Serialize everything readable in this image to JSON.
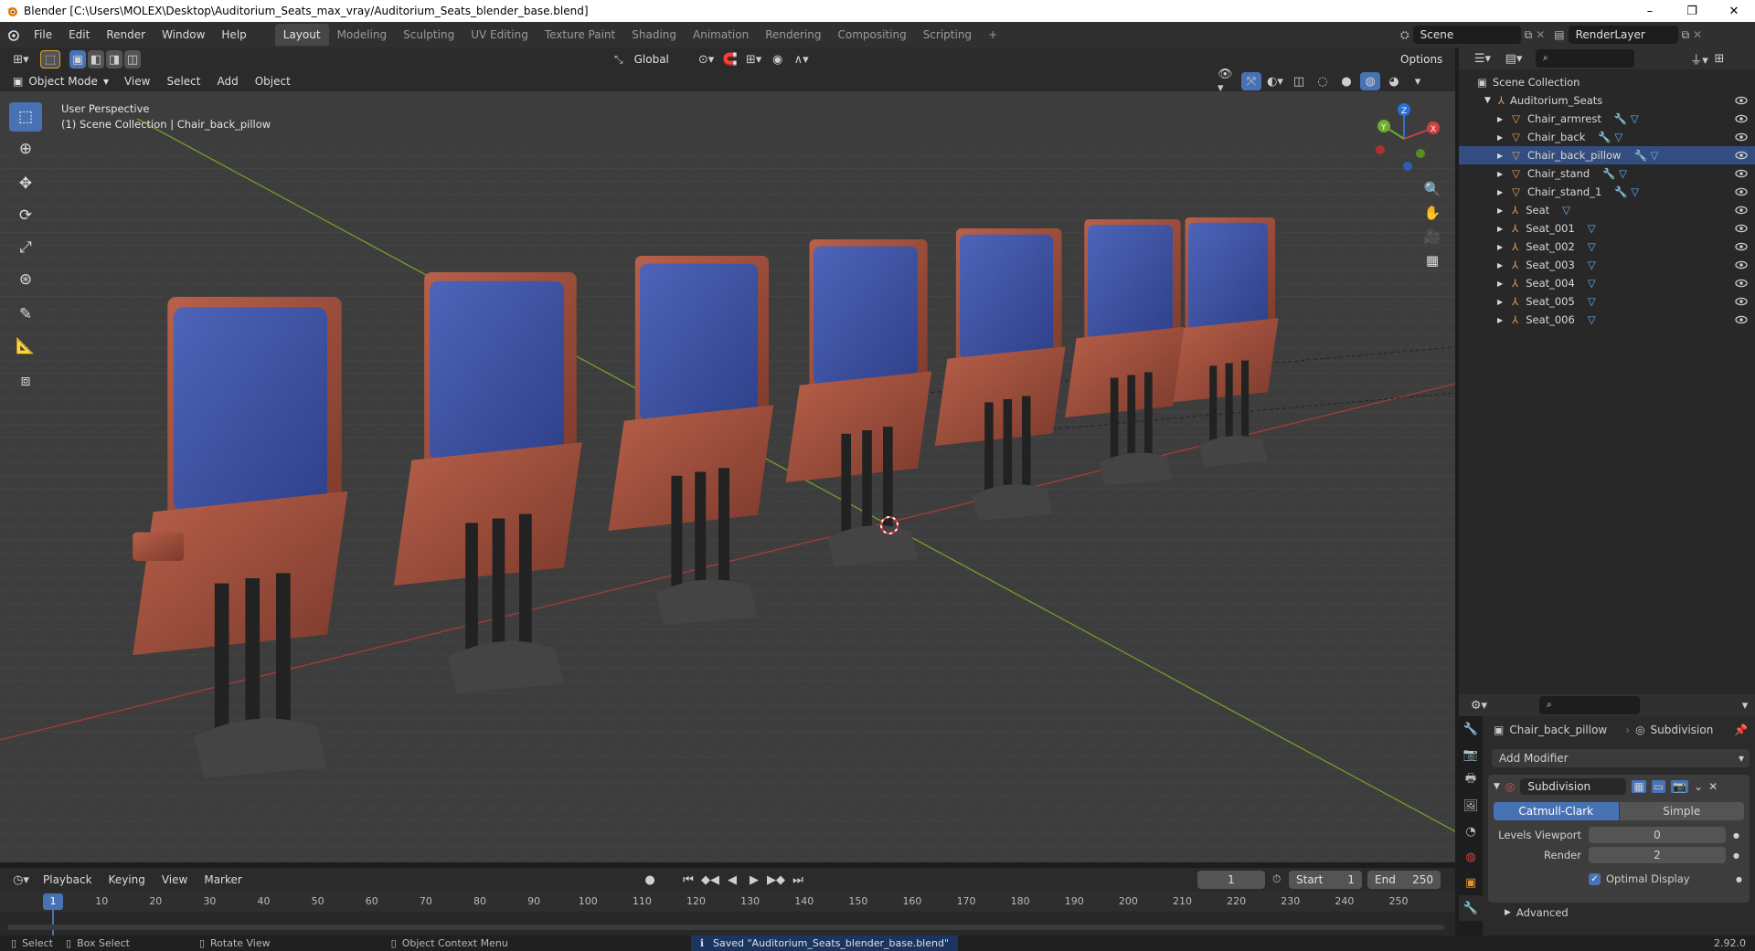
{
  "window": {
    "title": "Blender [C:\\Users\\MOLEX\\Desktop\\Auditorium_Seats_max_vray/Auditorium_Seats_blender_base.blend]",
    "minimize": "–",
    "restore": "❐",
    "close": "✕"
  },
  "menubar": {
    "items": [
      "File",
      "Edit",
      "Render",
      "Window",
      "Help"
    ],
    "workspaces": [
      "Layout",
      "Modeling",
      "Sculpting",
      "UV Editing",
      "Texture Paint",
      "Shading",
      "Animation",
      "Rendering",
      "Compositing",
      "Scripting"
    ],
    "active_workspace": "Layout",
    "add_workspace": "+",
    "scene": "Scene",
    "view_layer": "RenderLayer"
  },
  "viewport_header": {
    "mode": "Object Mode",
    "menus": [
      "View",
      "Select",
      "Add",
      "Object"
    ],
    "orientation": "Global",
    "options": "Options"
  },
  "viewport": {
    "perspective": "User Perspective",
    "collection_info": "(1) Scene Collection | Chair_back_pillow",
    "gizmo": {
      "x": "X",
      "y": "Y",
      "z": "Z"
    }
  },
  "tools": [
    "select-box",
    "cursor",
    "move",
    "rotate",
    "scale",
    "transform",
    "annotate",
    "measure",
    "add-cube"
  ],
  "outliner": {
    "root": "Scene Collection",
    "collection": "Auditorium_Seats",
    "items": [
      {
        "name": "Chair_armrest",
        "type": "mesh",
        "selected": false
      },
      {
        "name": "Chair_back",
        "type": "mesh",
        "selected": false
      },
      {
        "name": "Chair_back_pillow",
        "type": "mesh",
        "selected": true
      },
      {
        "name": "Chair_stand",
        "type": "mesh",
        "selected": false
      },
      {
        "name": "Chair_stand_1",
        "type": "mesh",
        "selected": false
      },
      {
        "name": "Seat",
        "type": "armature",
        "selected": false
      },
      {
        "name": "Seat_001",
        "type": "armature",
        "selected": false
      },
      {
        "name": "Seat_002",
        "type": "armature",
        "selected": false
      },
      {
        "name": "Seat_003",
        "type": "armature",
        "selected": false
      },
      {
        "name": "Seat_004",
        "type": "armature",
        "selected": false
      },
      {
        "name": "Seat_005",
        "type": "armature",
        "selected": false
      },
      {
        "name": "Seat_006",
        "type": "armature",
        "selected": false
      }
    ]
  },
  "properties": {
    "object": "Chair_back_pillow",
    "modifier_context": "Subdivision",
    "add_modifier": "Add Modifier",
    "modifier_name": "Subdivision",
    "type_options": [
      "Catmull-Clark",
      "Simple"
    ],
    "active_type": "Catmull-Clark",
    "levels_viewport_label": "Levels Viewport",
    "levels_viewport": "0",
    "render_label": "Render",
    "render": "2",
    "optimal_display": "Optimal Display",
    "advanced": "Advanced"
  },
  "timeline": {
    "menus": [
      "Playback",
      "Keying",
      "View",
      "Marker"
    ],
    "current_frame": "1",
    "start_label": "Start",
    "start": "1",
    "end_label": "End",
    "end": "250",
    "ticks": [
      "1",
      "10",
      "20",
      "30",
      "40",
      "50",
      "60",
      "70",
      "80",
      "90",
      "100",
      "110",
      "120",
      "130",
      "140",
      "150",
      "160",
      "170",
      "180",
      "190",
      "200",
      "210",
      "220",
      "230",
      "240",
      "250"
    ]
  },
  "statusbar": {
    "select": "Select",
    "box_select": "Box Select",
    "rotate_view": "Rotate View",
    "context_menu": "Object Context Menu",
    "message": "Saved \"Auditorium_Seats_blender_base.blend\"",
    "version": "2.92.0"
  },
  "colors": {
    "accent": "#4772b3",
    "selection": "#334d80",
    "seat_blue": "#3a4f9e",
    "seat_wood": "#9a4a38",
    "x_axis": "#d04040",
    "y_axis": "#70a830"
  }
}
